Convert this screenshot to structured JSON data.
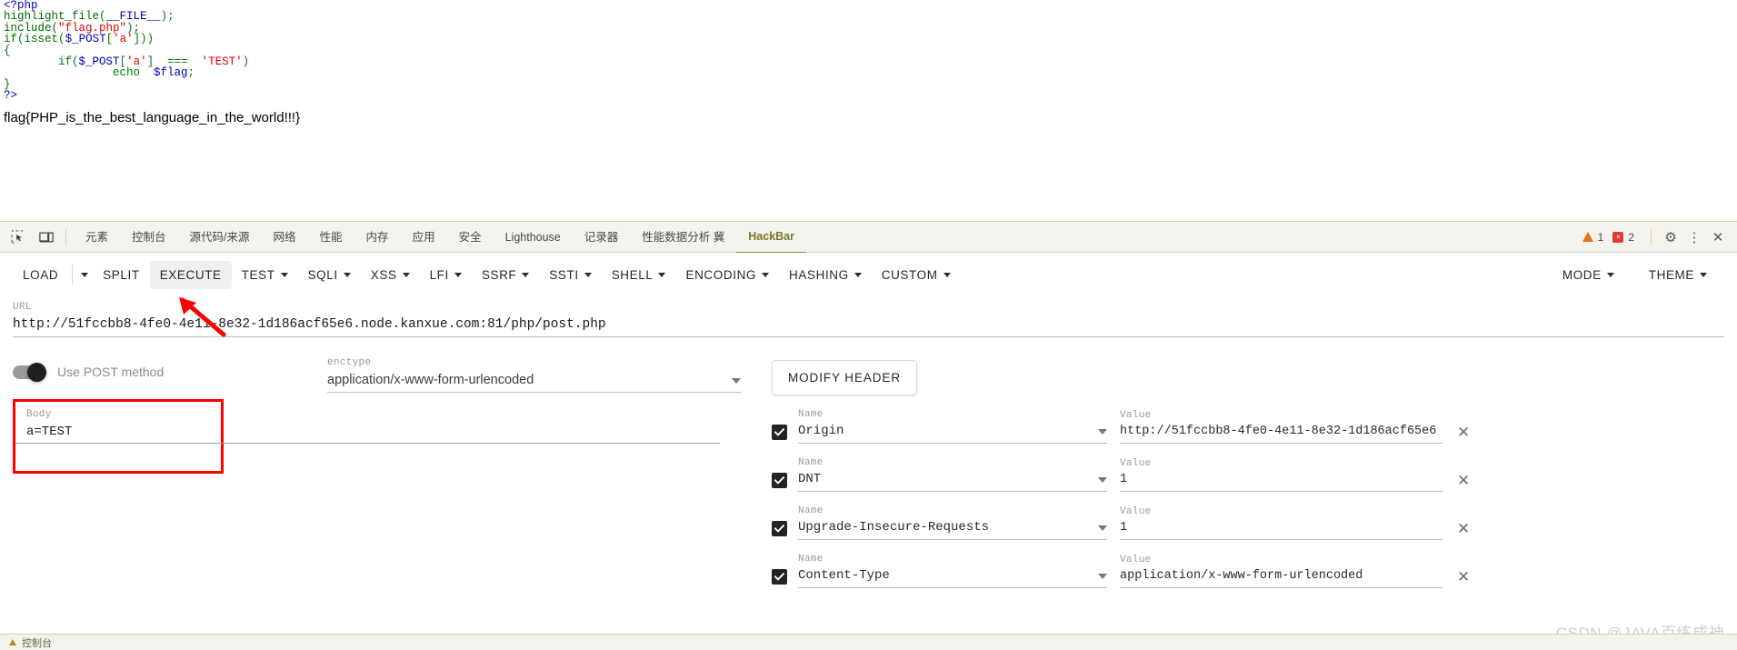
{
  "php_source": {
    "lines": [
      [
        {
          "t": "<?php",
          "c": "kw"
        }
      ],
      [
        {
          "t": "highlight_file",
          "c": "fn"
        },
        {
          "t": "(",
          "c": "op"
        },
        {
          "t": "__FILE__",
          "c": "kw"
        },
        {
          "t": ");",
          "c": "op"
        }
      ],
      [
        {
          "t": "include",
          "c": "fn"
        },
        {
          "t": "(",
          "c": "op"
        },
        {
          "t": "\"flag.php\"",
          "c": "str"
        },
        {
          "t": ");",
          "c": "op"
        }
      ],
      [
        {
          "t": "if",
          "c": "op"
        },
        {
          "t": "(",
          "c": "op"
        },
        {
          "t": "isset",
          "c": "fn"
        },
        {
          "t": "(",
          "c": "op"
        },
        {
          "t": "$_POST",
          "c": "var"
        },
        {
          "t": "[",
          "c": "op"
        },
        {
          "t": "'a'",
          "c": "str"
        },
        {
          "t": "]))",
          "c": "op"
        }
      ],
      [
        {
          "t": "{",
          "c": "op"
        }
      ],
      [
        {
          "t": "        if",
          "c": "op"
        },
        {
          "t": "(",
          "c": "op"
        },
        {
          "t": "$_POST",
          "c": "var"
        },
        {
          "t": "[",
          "c": "op"
        },
        {
          "t": "'a'",
          "c": "str"
        },
        {
          "t": "]  ===  ",
          "c": "op"
        },
        {
          "t": "'TEST'",
          "c": "str"
        },
        {
          "t": ")",
          "c": "op"
        }
      ],
      [
        {
          "t": "                echo  ",
          "c": "op"
        },
        {
          "t": "$flag",
          "c": "var"
        },
        {
          "t": ";",
          "c": "op"
        }
      ],
      [
        {
          "t": "}",
          "c": "op"
        }
      ],
      [
        {
          "t": "?>",
          "c": "kw"
        }
      ]
    ],
    "flag": "flag{PHP_is_the_best_language_in_the_world!!!}"
  },
  "devtools": {
    "tools": [
      {
        "name": "inspect-element-icon"
      },
      {
        "name": "device-toolbar-icon"
      }
    ],
    "tabs": [
      {
        "label": "元素",
        "active": false
      },
      {
        "label": "控制台",
        "active": false
      },
      {
        "label": "源代码/来源",
        "active": false
      },
      {
        "label": "网络",
        "active": false
      },
      {
        "label": "性能",
        "active": false
      },
      {
        "label": "内存",
        "active": false
      },
      {
        "label": "应用",
        "active": false
      },
      {
        "label": "安全",
        "active": false
      },
      {
        "label": "Lighthouse",
        "active": false
      },
      {
        "label": "记录器",
        "active": false
      },
      {
        "label": "性能数据分析 冀",
        "active": false
      },
      {
        "label": "HackBar",
        "active": true
      }
    ],
    "warning_count": "1",
    "error_count": "2",
    "error_badge_glyph": "×",
    "settings_icon": "⚙",
    "more_icon": "⋮",
    "close_icon": "✕"
  },
  "hackbar": {
    "toolbar": {
      "load": "LOAD",
      "split": "SPLIT",
      "execute": "EXECUTE",
      "menus": [
        "TEST",
        "SQLI",
        "XSS",
        "LFI",
        "SSRF",
        "SSTI",
        "SHELL",
        "ENCODING",
        "HASHING",
        "CUSTOM"
      ],
      "mode": "MODE",
      "theme": "THEME"
    },
    "url": {
      "label": "URL",
      "value": "http://51fccbb8-4fe0-4e11-8e32-1d186acf65e6.node.kanxue.com:81/php/post.php"
    },
    "post_toggle": {
      "label": "Use POST method",
      "enabled": true
    },
    "enctype": {
      "label": "enctype",
      "value": "application/x-www-form-urlencoded"
    },
    "body": {
      "label": "Body",
      "value": "a=TEST"
    },
    "modify_header_label": "MODIFY HEADER",
    "header_table": {
      "name_label": "Name",
      "value_label": "Value",
      "remove_label": "✕",
      "rows": [
        {
          "checked": true,
          "name": "Origin",
          "value": "http://51fccbb8-4fe0-4e11-8e32-1d186acf65e6"
        },
        {
          "checked": true,
          "name": "DNT",
          "value": "1"
        },
        {
          "checked": true,
          "name": "Upgrade-Insecure-Requests",
          "value": "1"
        },
        {
          "checked": true,
          "name": "Content-Type",
          "value": "application/x-www-form-urlencoded"
        }
      ]
    }
  },
  "annotations": {
    "arrow_color": "#fe0000",
    "body_box_color": "#fe0000"
  },
  "watermark": "CSDN @JAVA百练成神",
  "bottom_strip": {
    "label": "控制台"
  }
}
